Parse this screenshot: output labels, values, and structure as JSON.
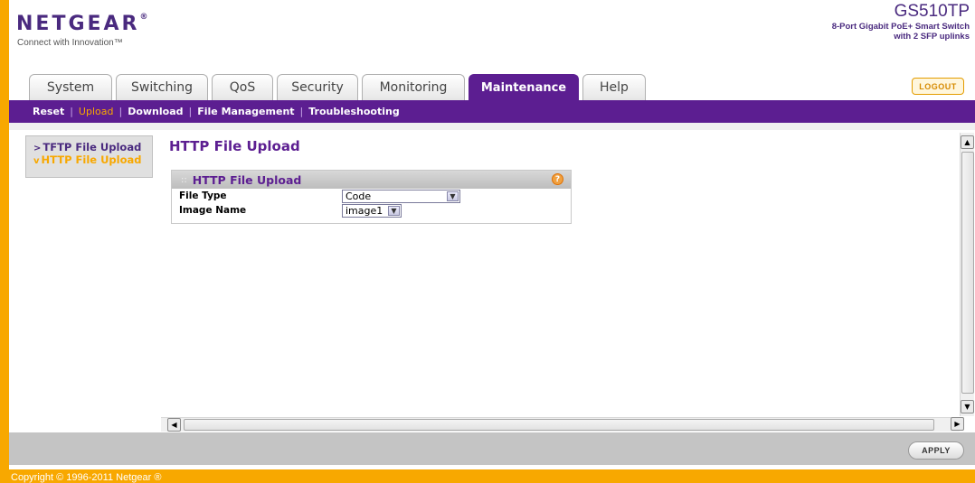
{
  "header": {
    "logo": "NETGEAR",
    "logo_mark": "®",
    "tagline": "Connect with Innovation™",
    "model": "GS510TP",
    "description_line1": "8-Port Gigabit PoE+ Smart Switch",
    "description_line2": "with 2 SFP uplinks"
  },
  "tabs": [
    {
      "label": "System"
    },
    {
      "label": "Switching"
    },
    {
      "label": "QoS"
    },
    {
      "label": "Security"
    },
    {
      "label": "Monitoring"
    },
    {
      "label": "Maintenance"
    },
    {
      "label": "Help"
    }
  ],
  "logout_label": "LOGOUT",
  "subnav": [
    {
      "label": "Reset"
    },
    {
      "label": "Upload"
    },
    {
      "label": "Download"
    },
    {
      "label": "File Management"
    },
    {
      "label": "Troubleshooting"
    }
  ],
  "leftnav": {
    "items": [
      {
        "label": "TFTP File Upload",
        "arrow": ">"
      },
      {
        "label": "HTTP File Upload",
        "arrow": "v"
      }
    ]
  },
  "page_title": "HTTP File Upload",
  "panel": {
    "title": "HTTP File Upload",
    "help_glyph": "?",
    "fields": [
      {
        "label": "File Type",
        "value": "Code"
      },
      {
        "label": "Image Name",
        "value": "image1"
      }
    ]
  },
  "apply_label": "APPLY",
  "copyright": "Copyright © 1996-2011 Netgear ®",
  "colors": {
    "brand_purple": "#5c1e91",
    "accent_orange": "#f8a800"
  }
}
